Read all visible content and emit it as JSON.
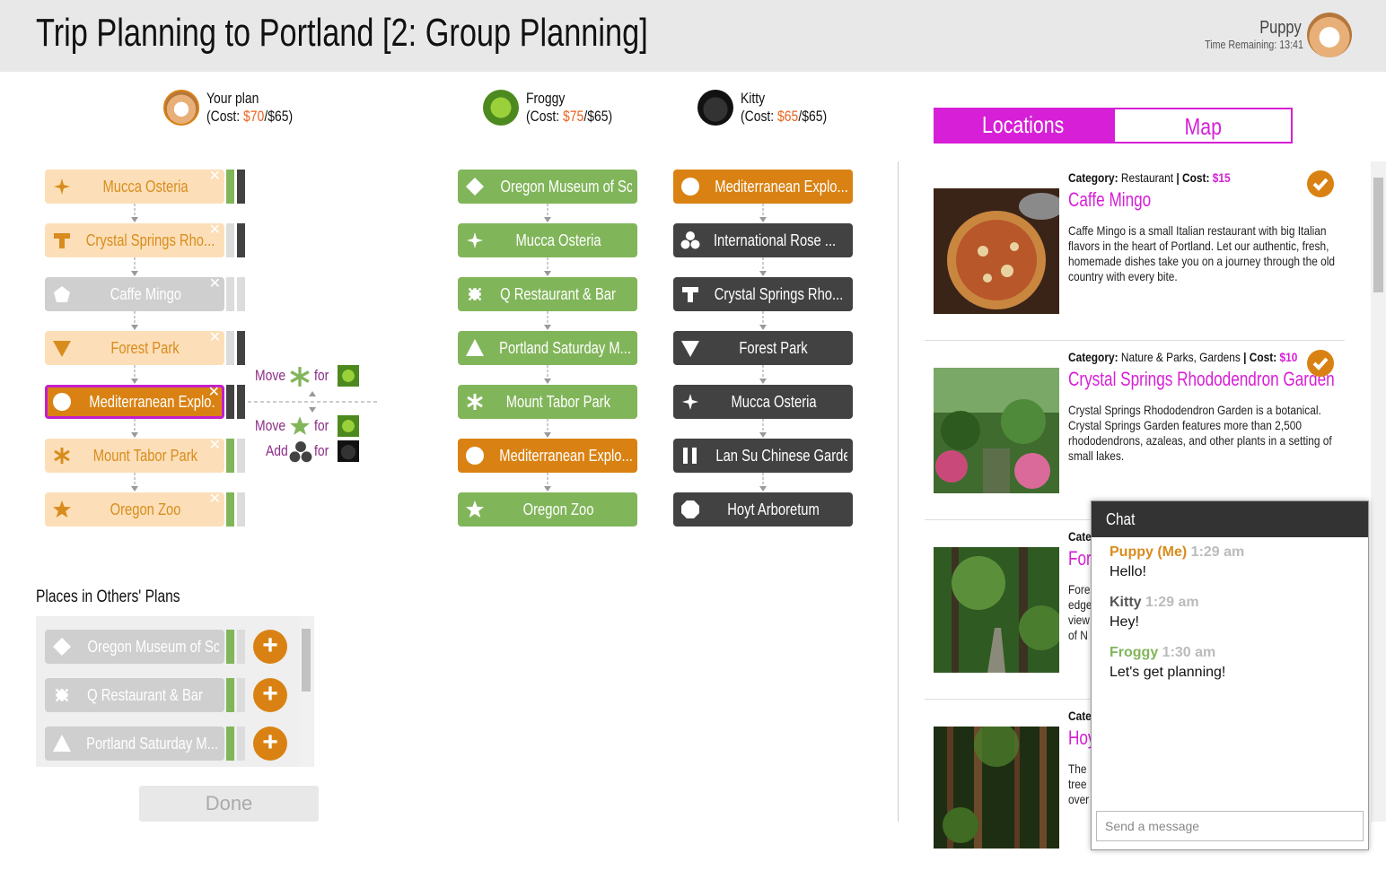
{
  "header": {
    "title": "Trip Planning to Portland [2: Group Planning]",
    "user_name": "Puppy",
    "time_remaining": "Time Remaining: 13:41"
  },
  "plans": [
    {
      "owner": "Your plan",
      "cost_prefix": "(Cost: ",
      "cost": "$70",
      "budget": "/$65)",
      "items": [
        {
          "label": "Mucca Osteria",
          "icon": "sparkle-icon"
        },
        {
          "label": "Crystal Springs Rho...",
          "icon": "t-shape-icon"
        },
        {
          "label": "Caffe Mingo",
          "icon": "pentagon-icon"
        },
        {
          "label": "Forest Park",
          "icon": "triangle-down-icon"
        },
        {
          "label": "Mediterranean Explo...",
          "icon": "circle-icon"
        },
        {
          "label": "Mount Tabor Park",
          "icon": "asterisk-icon"
        },
        {
          "label": "Oregon Zoo",
          "icon": "star-icon"
        }
      ]
    },
    {
      "owner": "Froggy",
      "cost_prefix": "(Cost: ",
      "cost": "$75",
      "budget": "/$65)",
      "items": [
        {
          "label": "Oregon Museum of Sc...",
          "icon": "diamond-icon"
        },
        {
          "label": "Mucca Osteria",
          "icon": "sparkle-icon"
        },
        {
          "label": "Q Restaurant & Bar",
          "icon": "puzzle-icon"
        },
        {
          "label": "Portland Saturday M...",
          "icon": "triangle-up-icon"
        },
        {
          "label": "Mount Tabor Park",
          "icon": "asterisk-icon"
        },
        {
          "label": "Mediterranean Explo...",
          "icon": "circle-icon"
        },
        {
          "label": "Oregon Zoo",
          "icon": "star-icon"
        }
      ]
    },
    {
      "owner": "Kitty",
      "cost_prefix": "(Cost: ",
      "cost": "$65",
      "budget": "/$65)",
      "items": [
        {
          "label": "Mediterranean Explo...",
          "icon": "circle-icon"
        },
        {
          "label": "International Rose ...",
          "icon": "trefoil-icon"
        },
        {
          "label": "Crystal Springs Rho...",
          "icon": "t-shape-icon"
        },
        {
          "label": "Forest Park",
          "icon": "triangle-down-icon"
        },
        {
          "label": "Mucca Osteria",
          "icon": "sparkle-icon"
        },
        {
          "label": "Lan Su Chinese Garden",
          "icon": "bars-icon"
        },
        {
          "label": "Hoyt Arboretum",
          "icon": "octagon-icon"
        }
      ]
    }
  ],
  "suggestions": {
    "move1": "Move",
    "for1": "for",
    "move2": "Move",
    "for2": "for",
    "add": "Add",
    "for3": "for"
  },
  "others": {
    "title": "Places in Others' Plans",
    "items": [
      {
        "label": "Oregon Museum of Sc..."
      },
      {
        "label": "Q Restaurant & Bar"
      },
      {
        "label": "Portland Saturday M..."
      }
    ],
    "plus": "+"
  },
  "done_label": "Done",
  "tabs": {
    "locations": "Locations",
    "map": "Map"
  },
  "locations": [
    {
      "category_label": "Category:",
      "category": "Restaurant",
      "cost_label": "| Cost:",
      "cost": "$15",
      "name": "Caffe Mingo",
      "desc": "Caffe Mingo is a small Italian restaurant with big Italian flavors in the heart of Portland. Let our authentic, fresh, homemade dishes take you on a journey through the old country with every bite."
    },
    {
      "category_label": "Category:",
      "category": "Nature & Parks, Gardens",
      "cost_label": "| Cost:",
      "cost": "$10",
      "name": "Crystal Springs Rhododendron Garden",
      "desc": "Crystal Springs Rhododendron Garden is a botanical. Crystal Springs Garden features more than 2,500 rhododendrons, azaleas, and other plants in a setting of small lakes."
    },
    {
      "category_label": "Cate",
      "name": "For",
      "desc_lines": [
        "Fore",
        "edge",
        "view",
        "of N"
      ]
    },
    {
      "category_label": "Cate",
      "name": "Hoy",
      "desc_lines": [
        "The",
        "tree",
        "over"
      ]
    }
  ],
  "chat": {
    "title": "Chat",
    "messages": [
      {
        "who": "Puppy (Me)",
        "when": "1:29 am",
        "text": "Hello!",
        "color": "#d98c1e"
      },
      {
        "who": "Kitty",
        "when": "1:29 am",
        "text": "Hey!",
        "color": "#555555"
      },
      {
        "who": "Froggy",
        "when": "1:30 am",
        "text": "Let's get planning!",
        "color": "#81b55a"
      }
    ],
    "placeholder": "Send a message"
  },
  "colors": {
    "accent": "#d61fd6",
    "green": "#81b55a",
    "orange": "#d98213",
    "dark": "#424242",
    "peach": "#fcdfb8"
  }
}
